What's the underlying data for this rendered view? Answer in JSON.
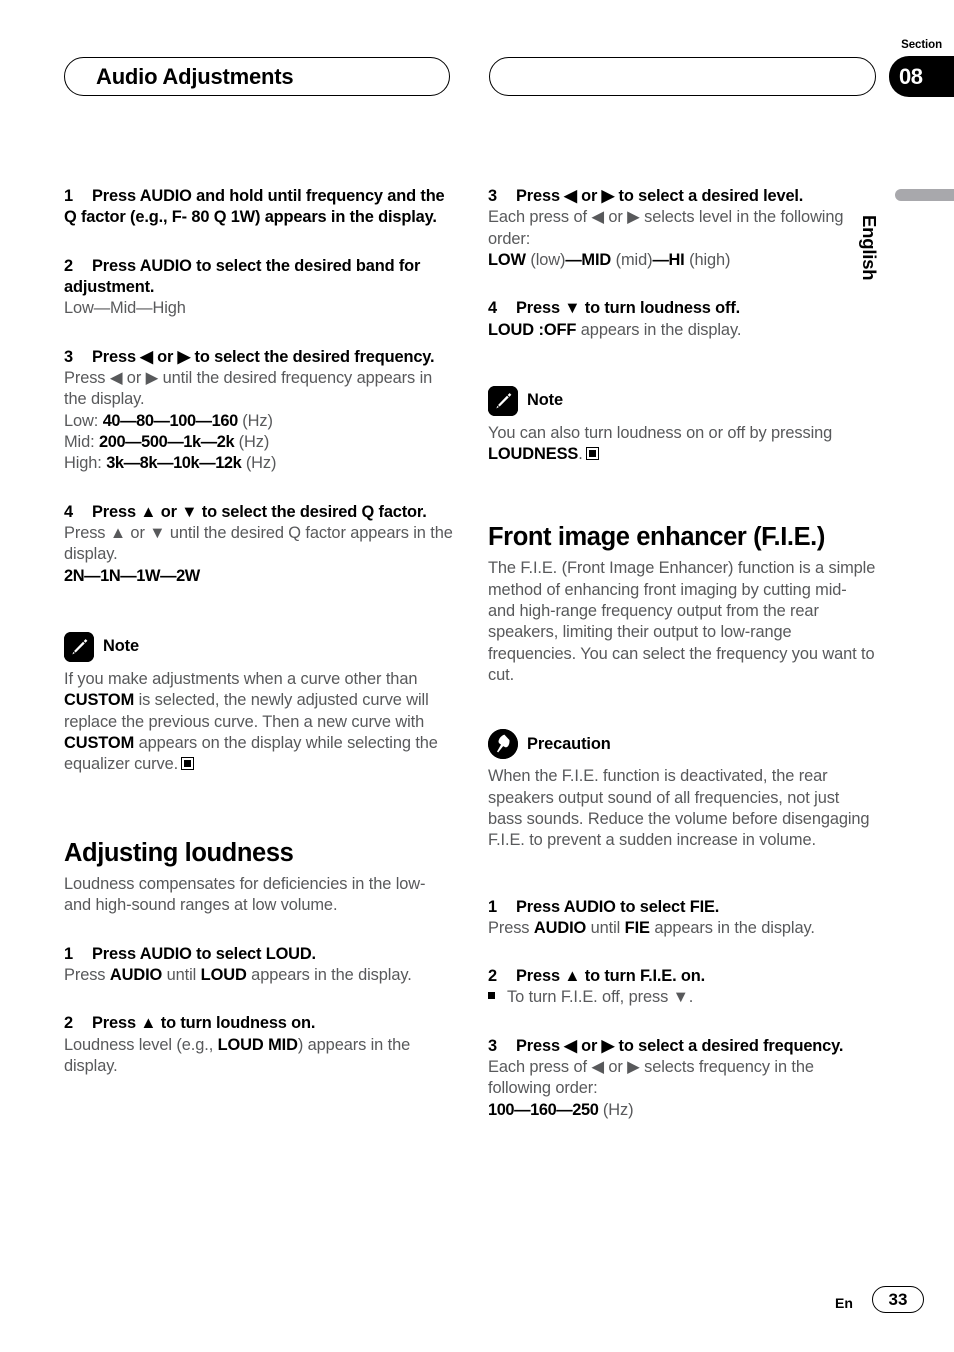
{
  "header": {
    "title": "Audio Adjustments",
    "section_label": "Section",
    "section_number": "08",
    "language_tab": "English"
  },
  "footer": {
    "lang_code": "En",
    "page_number": "33"
  },
  "left_column": {
    "step1": {
      "num": "1",
      "head": "Press AUDIO and hold until frequency and the Q factor (e.g., F- 80 Q 1W) appears in the display."
    },
    "step2": {
      "num": "2",
      "head": "Press AUDIO to select the desired band for adjustment.",
      "body": "Low—Mid—High"
    },
    "step3": {
      "num": "3",
      "head": "Press ◀ or ▶ to select the desired frequency.",
      "body": "Press ◀ or ▶ until the desired frequency appears in the display.",
      "low_label": "Low: ",
      "low_values": "40—80—100—160",
      "low_unit": " (Hz)",
      "mid_label": "Mid: ",
      "mid_values": "200—500—1k—2k",
      "mid_unit": " (Hz)",
      "high_label": "High: ",
      "high_values": "3k—8k—10k—12k",
      "high_unit": " (Hz)"
    },
    "step4": {
      "num": "4",
      "head": "Press ▲ or ▼ to select the desired Q factor.",
      "body": "Press ▲ or ▼ until the desired Q factor appears in the display.",
      "values": "2N—1N—1W—2W"
    },
    "note": {
      "icon": "pencil-icon",
      "title": "Note",
      "text_a": "If you make adjustments when a curve other than ",
      "bold_a": "CUSTOM",
      "text_b": " is selected, the newly adjusted curve will replace the previous curve. Then a new curve with ",
      "bold_b": "CUSTOM",
      "text_c": " appears on the display while selecting the equalizer curve."
    },
    "loudness": {
      "heading": "Adjusting loudness",
      "intro": "Loudness compensates for deficiencies in the low- and high-sound ranges at low volume.",
      "step1": {
        "num": "1",
        "head": "Press AUDIO to select LOUD.",
        "text_a": "Press ",
        "bold_a": "AUDIO",
        "text_b": " until ",
        "bold_b": "LOUD",
        "text_c": " appears in the display."
      },
      "step2": {
        "num": "2",
        "head": "Press ▲ to turn loudness on.",
        "text_a": "Loudness level (e.g., ",
        "bold_a": "LOUD MID",
        "text_b": ") appears in the display."
      }
    }
  },
  "right_column": {
    "step3": {
      "num": "3",
      "head": "Press ◀ or ▶ to select a desired level.",
      "body": "Each press of ◀ or ▶ selects level in the following order:",
      "order_low_b": "LOW",
      "order_low_p": " (low)",
      "dash1": "—",
      "order_mid_b": "MID",
      "order_mid_p": " (mid)",
      "dash2": "—",
      "order_hi_b": "HI",
      "order_hi_p": " (high)"
    },
    "step4": {
      "num": "4",
      "head": "Press ▼ to turn loudness off.",
      "bold_a": "LOUD :OFF",
      "text_a": " appears in the display."
    },
    "note": {
      "icon": "pencil-icon",
      "title": "Note",
      "text_a": "You can also turn loudness on or off by pressing ",
      "bold_a": "LOUDNESS",
      "text_b": "."
    },
    "fie": {
      "heading": "Front image enhancer (F.I.E.)",
      "intro": "The F.I.E. (Front Image Enhancer) function is a simple method of enhancing front imaging by cutting mid- and high-range frequency output from the rear speakers, limiting their output to low-range frequencies. You can select the frequency you want to cut.",
      "precaution": {
        "icon": "pushpin-icon",
        "title": "Precaution",
        "text": "When the F.I.E. function is deactivated, the rear speakers output sound of all frequencies, not just bass sounds. Reduce the volume before disengaging F.I.E. to prevent a sudden increase in volume."
      },
      "step1": {
        "num": "1",
        "head": "Press AUDIO to select FIE.",
        "text_a": "Press ",
        "bold_a": "AUDIO",
        "text_b": " until ",
        "bold_b": "FIE",
        "text_c": " appears in the display."
      },
      "step2": {
        "num": "2",
        "head": "Press ▲ to turn F.I.E. on.",
        "bullet": "To turn F.I.E. off, press ▼."
      },
      "step3": {
        "num": "3",
        "head": "Press ◀ or ▶ to select a desired frequency.",
        "body": "Each press of ◀ or ▶ selects frequency in the following order:",
        "values": "100—160—250",
        "unit": " (Hz)"
      }
    }
  }
}
